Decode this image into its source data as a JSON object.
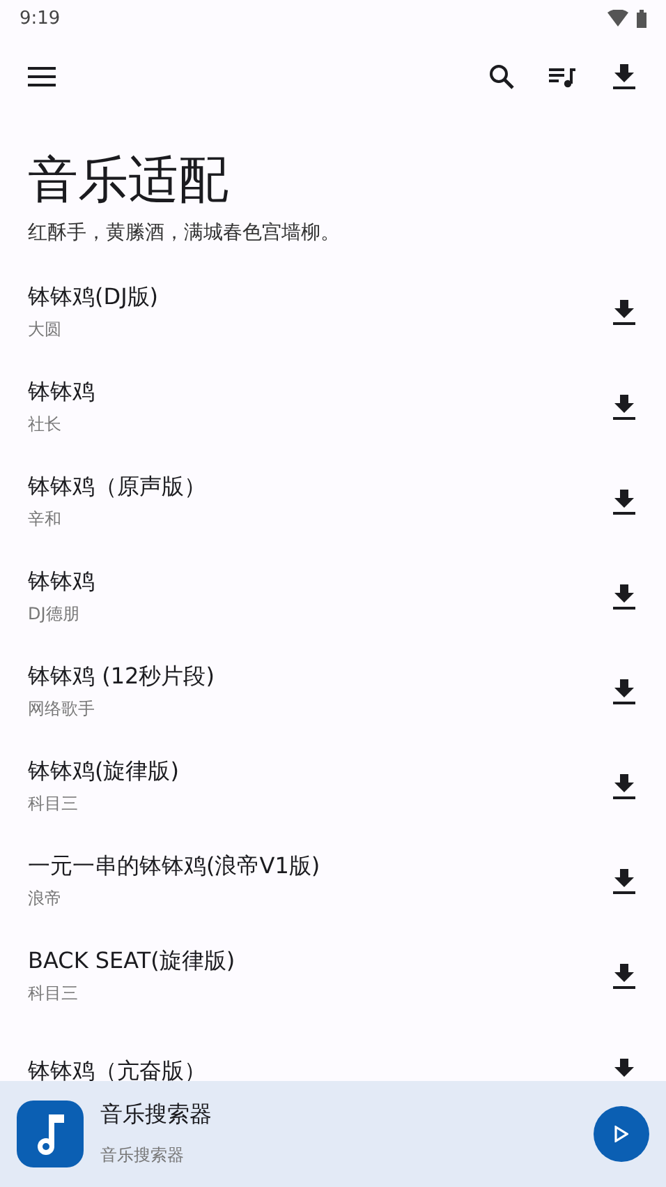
{
  "status_bar": {
    "time": "9:19"
  },
  "header": {
    "title": "音乐适配",
    "subtitle": "红酥手，黄縢酒，满城春色宫墙柳。"
  },
  "songs": [
    {
      "title": "钵钵鸡(DJ版)",
      "artist": "大圆"
    },
    {
      "title": "钵钵鸡",
      "artist": "社长"
    },
    {
      "title": "钵钵鸡（原声版）",
      "artist": "辛和"
    },
    {
      "title": "钵钵鸡",
      "artist": "DJ德朋"
    },
    {
      "title": "钵钵鸡 (12秒片段)",
      "artist": "网络歌手"
    },
    {
      "title": "钵钵鸡(旋律版)",
      "artist": "科目三"
    },
    {
      "title": "一元一串的钵钵鸡(浪帝V1版)",
      "artist": "浪帝"
    },
    {
      "title": "BACK SEAT(旋律版)",
      "artist": "科目三"
    },
    {
      "title": "钵钵鸡（亢奋版）"
    }
  ],
  "player": {
    "title": "音乐搜索器",
    "subtitle": "音乐搜索器"
  }
}
